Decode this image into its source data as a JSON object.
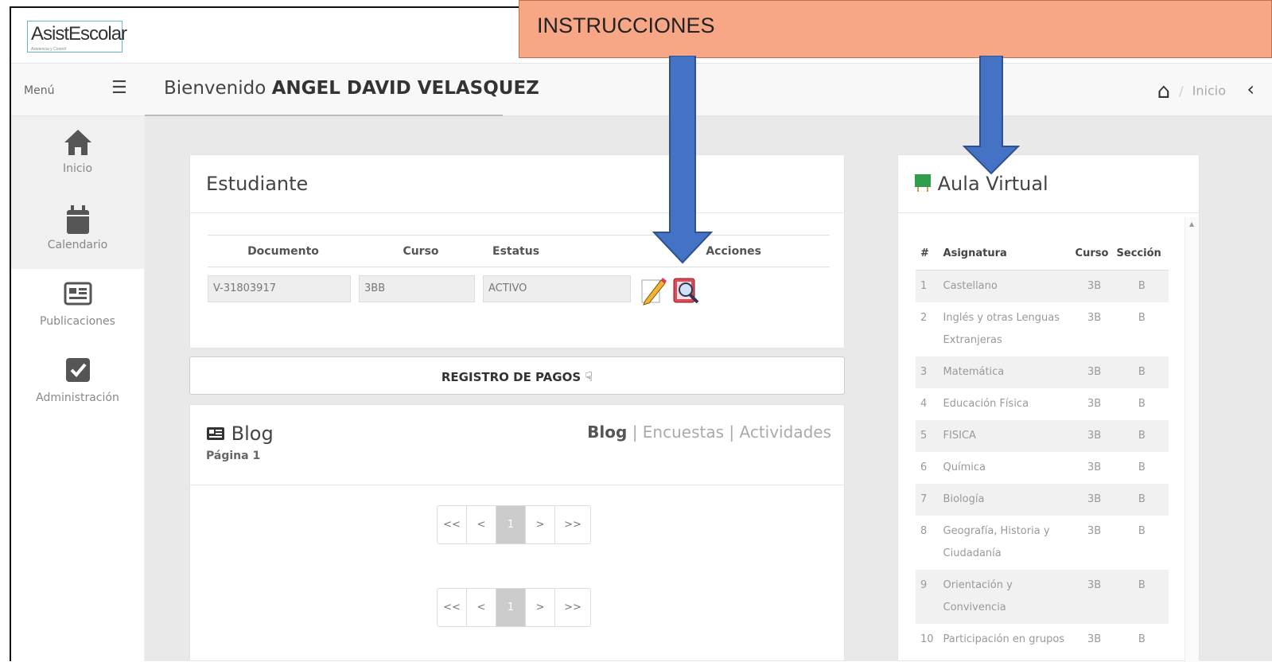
{
  "app": {
    "logo_text": "AsistEscolar",
    "logo_tagline": "Asistencia y Control"
  },
  "banner": {
    "text": "INSTRUCCIONES"
  },
  "header": {
    "menu_label": "Menú",
    "welcome_prefix": "Bienvenido",
    "user_name": "ANGEL DAVID VELASQUEZ",
    "breadcrumb": "Inicio"
  },
  "sidebar": {
    "items": [
      {
        "label": "Inicio",
        "icon": "home-icon"
      },
      {
        "label": "Calendario",
        "icon": "calendar-icon"
      },
      {
        "label": "Publicaciones",
        "icon": "newspaper-icon"
      },
      {
        "label": "Administración",
        "icon": "checkbox-icon"
      }
    ]
  },
  "student": {
    "title": "Estudiante",
    "columns": [
      "Documento",
      "Curso",
      "Estatus",
      "Acciones"
    ],
    "documento": "V-31803917",
    "curso": "3BB",
    "estatus": "ACTIVO"
  },
  "pagos": {
    "label": "REGISTRO DE PAGOS"
  },
  "blog": {
    "title": "Blog",
    "subtitle": "Página 1",
    "tabs": [
      "Blog",
      "Encuestas",
      "Actividades"
    ],
    "pager": [
      "<<",
      "<",
      "1",
      ">",
      ">>"
    ]
  },
  "aula": {
    "title": "Aula Virtual",
    "columns": [
      "#",
      "Asignatura",
      "Curso",
      "Sección"
    ],
    "rows": [
      {
        "n": "1",
        "asignatura": "Castellano",
        "curso": "3B",
        "seccion": "B"
      },
      {
        "n": "2",
        "asignatura": "Inglés y otras Lenguas Extranjeras",
        "curso": "3B",
        "seccion": "B"
      },
      {
        "n": "3",
        "asignatura": "Matemática",
        "curso": "3B",
        "seccion": "B"
      },
      {
        "n": "4",
        "asignatura": "Educación Física",
        "curso": "3B",
        "seccion": "B"
      },
      {
        "n": "5",
        "asignatura": "FISICA",
        "curso": "3B",
        "seccion": "B"
      },
      {
        "n": "6",
        "asignatura": "Química",
        "curso": "3B",
        "seccion": "B"
      },
      {
        "n": "7",
        "asignatura": "Biología",
        "curso": "3B",
        "seccion": "B"
      },
      {
        "n": "8",
        "asignatura": "Geografía, Historia y Ciudadanía",
        "curso": "3B",
        "seccion": "B"
      },
      {
        "n": "9",
        "asignatura": "Orientación y Convivencia",
        "curso": "3B",
        "seccion": "B"
      },
      {
        "n": "10",
        "asignatura": "Participación en grupos",
        "curso": "3B",
        "seccion": "B"
      }
    ]
  },
  "colors": {
    "banner": "#f7a785",
    "arrow": "#4472c4",
    "aula_icon": "#2e9e4a"
  }
}
